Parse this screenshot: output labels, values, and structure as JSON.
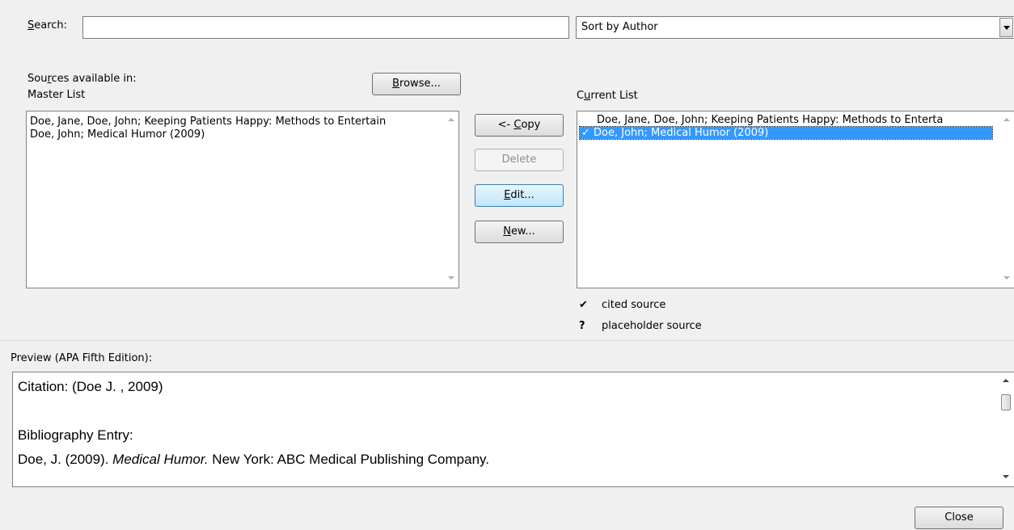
{
  "search": {
    "label_prefix": "",
    "label_access": "S",
    "label_rest": "earch:",
    "value": ""
  },
  "sort": {
    "selected": "Sort by Author"
  },
  "sources": {
    "label_line1_pre": "Sou",
    "label_line1_access": "r",
    "label_line1_post": "ces available in:",
    "label_line2": "Master List",
    "browse_pre": "",
    "browse_access": "B",
    "browse_post": "rowse..."
  },
  "master_list": {
    "items": [
      "Doe, Jane, Doe, John; Keeping Patients Happy: Methods to Entertain",
      "Doe, John; Medical Humor (2009)"
    ]
  },
  "actions": {
    "copy_pre": "<- ",
    "copy_access": "C",
    "copy_post": "opy",
    "delete": "Delete",
    "edit_access": "E",
    "edit_post": "dit...",
    "new_access": "N",
    "new_post": "ew..."
  },
  "current_list": {
    "label_pre": "C",
    "label_access": "u",
    "label_post": "rrent List",
    "items": [
      "Doe, Jane, Doe, John; Keeping Patients Happy: Methods to Enterta",
      "Doe, John; Medical Humor (2009)"
    ],
    "check_mark": "✓"
  },
  "legend": {
    "cited_symbol": "✔",
    "cited_label": "cited source",
    "placeholder_symbol": "?",
    "placeholder_label": "placeholder source"
  },
  "preview": {
    "label": "Preview (APA Fifth Edition):",
    "citation": "Citation:  (Doe J. , 2009)",
    "bib_heading": "Bibliography Entry:",
    "bib_prefix": "Doe, J. (2009). ",
    "bib_title": "Medical Humor.",
    "bib_suffix": " New York: ABC Medical Publishing Company."
  },
  "close_label": "Close"
}
